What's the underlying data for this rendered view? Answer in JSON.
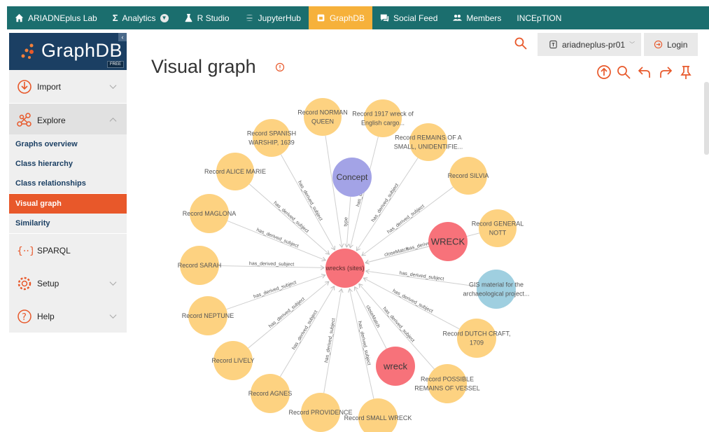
{
  "topnav": {
    "items": [
      {
        "label": "ARIADNEplus Lab",
        "icon": "home-icon"
      },
      {
        "label": "Analytics",
        "icon": "sigma-icon"
      },
      {
        "label": "R Studio",
        "icon": "flask-icon"
      },
      {
        "label": "JupyterHub",
        "icon": "jupyter-icon"
      },
      {
        "label": "GraphDB",
        "icon": "graphdb-icon",
        "active": true
      },
      {
        "label": "Social Feed",
        "icon": "chat-icon"
      },
      {
        "label": "Members",
        "icon": "people-icon"
      },
      {
        "label": "INCEpTION",
        "icon": ""
      }
    ]
  },
  "sidebar": {
    "logo_text": "GraphDB",
    "logo_badge": "FREE",
    "collapse_glyph": "‹",
    "items": [
      {
        "label": "Import",
        "icon": "import-icon"
      },
      {
        "label": "Explore",
        "icon": "explore-icon"
      },
      {
        "label": "SPARQL",
        "icon": "sparql-icon"
      },
      {
        "label": "Setup",
        "icon": "gear-icon"
      },
      {
        "label": "Help",
        "icon": "help-icon"
      }
    ],
    "explore_sub": [
      {
        "label": "Graphs overview"
      },
      {
        "label": "Class hierarchy"
      },
      {
        "label": "Class relationships"
      },
      {
        "label": "Visual graph",
        "active": true
      },
      {
        "label": "Similarity"
      }
    ]
  },
  "header": {
    "title": "Visual graph",
    "repository": "ariadneplus-pr01",
    "login_label": "Login",
    "accent": "#e8582a"
  },
  "graph": {
    "center": {
      "label": "wrecks (sites)",
      "color": "#f7727a"
    },
    "edge_label_default": "has_derived_subject",
    "nodes": [
      {
        "id": "n0",
        "lines": [
          "Record NORMAN",
          "QUEEN"
        ],
        "color": "#fdd281",
        "edge": ""
      },
      {
        "id": "n1",
        "lines": [
          "Record 1917 wreck of",
          "English cargo..."
        ],
        "color": "#fdd281",
        "edge": "has_derived..."
      },
      {
        "id": "n2",
        "lines": [
          "Record SPANISH",
          "WARSHIP, 1639"
        ],
        "color": "#fdd281",
        "edge": "has_derived_subject"
      },
      {
        "id": "n3",
        "lines": [
          "Concept"
        ],
        "color": "#a3a3e6",
        "edge": "type"
      },
      {
        "id": "n4",
        "lines": [
          "Record REMAINS OF A",
          "SMALL, UNIDENTIFIE..."
        ],
        "color": "#fdd281",
        "edge": "has_derived_subject"
      },
      {
        "id": "n5",
        "lines": [
          "Record ALICE MARIE"
        ],
        "color": "#fdd281",
        "edge": "has_derived_subject"
      },
      {
        "id": "n6",
        "lines": [
          "Record SILVIA"
        ],
        "color": "#fdd281",
        "edge": "has_derived_subject"
      },
      {
        "id": "n7",
        "lines": [
          "Record MAGLONA"
        ],
        "color": "#fdd281",
        "edge": "has_derived_subject"
      },
      {
        "id": "n8",
        "lines": [
          "WRECK"
        ],
        "color": "#f7727a",
        "edge": "closeMatch"
      },
      {
        "id": "n9",
        "lines": [
          "Record GENERAL",
          "NOTT"
        ],
        "color": "#fdd281",
        "edge": "has_derived..."
      },
      {
        "id": "n10",
        "lines": [
          "Record SARAH"
        ],
        "color": "#fdd281",
        "edge": "has_derived_subject"
      },
      {
        "id": "n11",
        "lines": [
          "GIS material for the",
          "archaeological project..."
        ],
        "color": "#9fcfe0",
        "edge": "has_derived_subject"
      },
      {
        "id": "n12",
        "lines": [
          "Record NEPTUNE"
        ],
        "color": "#fdd281",
        "edge": "has_derived_subject"
      },
      {
        "id": "n13",
        "lines": [
          "Record DUTCH CRAFT,",
          "1709"
        ],
        "color": "#fdd281",
        "edge": "has_derived_subject"
      },
      {
        "id": "n14",
        "lines": [
          "Record LIVELY"
        ],
        "color": "#fdd281",
        "edge": "has_derived_subject"
      },
      {
        "id": "n15",
        "lines": [
          "wreck"
        ],
        "color": "#f7727a",
        "edge": "closeMatch"
      },
      {
        "id": "n16",
        "lines": [
          "Record POSSIBLE",
          "REMAINS OF VESSEL"
        ],
        "color": "#fdd281",
        "edge": "has_derived_subject"
      },
      {
        "id": "n17",
        "lines": [
          "Record AGNES"
        ],
        "color": "#fdd281",
        "edge": "has_derived_subject"
      },
      {
        "id": "n18",
        "lines": [
          "Record PROVIDENCE"
        ],
        "color": "#fdd281",
        "edge": "has_derived_subject"
      },
      {
        "id": "n19",
        "lines": [
          "Record SMALL WRECK"
        ],
        "color": "#fdd281",
        "edge": "has_derived_subject"
      }
    ]
  }
}
